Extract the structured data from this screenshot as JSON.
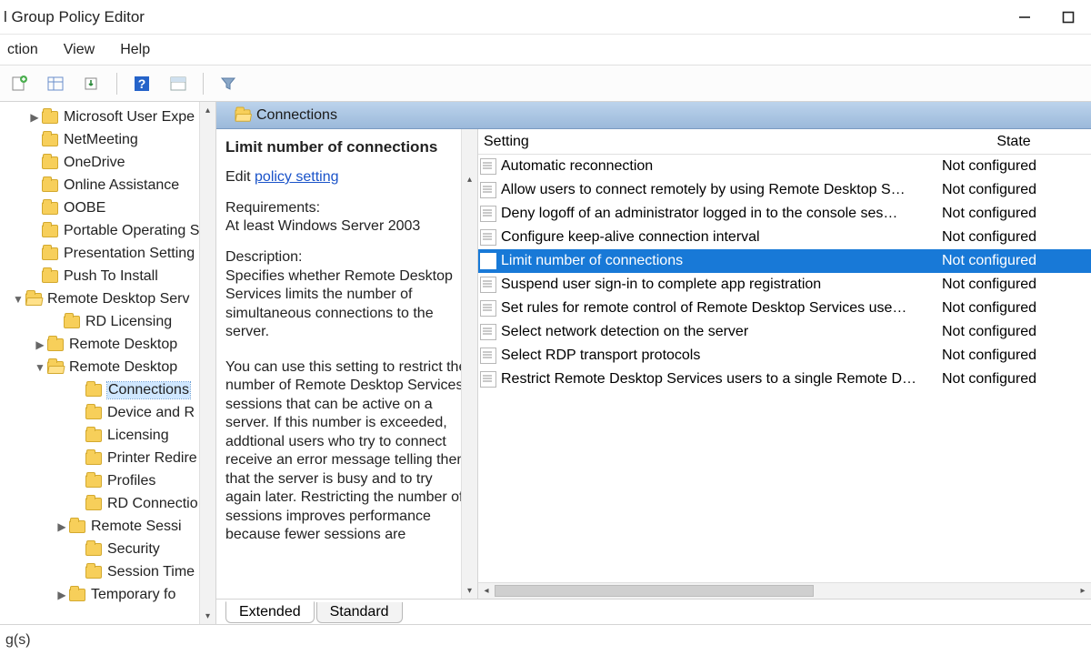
{
  "window": {
    "title": "l Group Policy Editor"
  },
  "menu": {
    "items": [
      "ction",
      "View",
      "Help"
    ]
  },
  "toolbar": {
    "buttons": [
      "new",
      "show-hide-tree",
      "export",
      "help",
      "properties",
      "filter"
    ]
  },
  "tree": {
    "items": [
      {
        "label": "Microsoft User Expe",
        "indent": 46,
        "disclosure": "▶"
      },
      {
        "label": "NetMeeting",
        "indent": 46
      },
      {
        "label": "OneDrive",
        "indent": 46
      },
      {
        "label": "Online Assistance",
        "indent": 46
      },
      {
        "label": "OOBE",
        "indent": 46
      },
      {
        "label": "Portable Operating S",
        "indent": 46
      },
      {
        "label": "Presentation Setting",
        "indent": 46
      },
      {
        "label": "Push To Install",
        "indent": 46
      },
      {
        "label": "Remote Desktop Serv",
        "indent": 28,
        "disclosure": "▼",
        "open": true
      },
      {
        "label": "RD Licensing",
        "indent": 70
      },
      {
        "label": "Remote Desktop",
        "indent": 52,
        "disclosure": "▶"
      },
      {
        "label": "Remote Desktop",
        "indent": 52,
        "disclosure": "▼",
        "open": true
      },
      {
        "label": "Connections",
        "indent": 94,
        "selected": true
      },
      {
        "label": "Device and R",
        "indent": 94
      },
      {
        "label": "Licensing",
        "indent": 94
      },
      {
        "label": "Printer Redire",
        "indent": 94
      },
      {
        "label": "Profiles",
        "indent": 94
      },
      {
        "label": "RD Connectio",
        "indent": 94
      },
      {
        "label": "Remote Sessi",
        "indent": 76,
        "disclosure": "▶"
      },
      {
        "label": "Security",
        "indent": 94
      },
      {
        "label": "Session Time",
        "indent": 94
      },
      {
        "label": "Temporary fo",
        "indent": 76,
        "disclosure": "▶"
      }
    ]
  },
  "pathHeader": {
    "label": "Connections"
  },
  "description": {
    "heading": "Limit number of connections",
    "editPrefix": "Edit ",
    "editLink": "policy setting",
    "reqLabel": "Requirements:",
    "reqValue": "At least Windows Server 2003",
    "descLabel": "Description:",
    "body1": "Specifies whether Remote Desktop Services limits the number of simultaneous connections to the server.",
    "body2": "You can use this setting to restrict the number of Remote Desktop Services sessions that can be active on a server. If this number is exceeded, addtional users who try to connect receive an error message telling them that the server is busy and to try again later. Restricting the number of sessions improves performance because fewer sessions are"
  },
  "list": {
    "columns": {
      "setting": "Setting",
      "state": "State"
    },
    "rows": [
      {
        "label": "Automatic reconnection",
        "state": "Not configured"
      },
      {
        "label": "Allow users to connect remotely by using Remote Desktop S…",
        "state": "Not configured"
      },
      {
        "label": "Deny logoff of an administrator logged in to the console ses…",
        "state": "Not configured"
      },
      {
        "label": "Configure keep-alive connection interval",
        "state": "Not configured"
      },
      {
        "label": "Limit number of connections",
        "state": "Not configured",
        "selected": true
      },
      {
        "label": "Suspend user sign-in to complete app registration",
        "state": "Not configured"
      },
      {
        "label": "Set rules for remote control of Remote Desktop Services use…",
        "state": "Not configured"
      },
      {
        "label": "Select network detection on the server",
        "state": "Not configured"
      },
      {
        "label": "Select RDP transport protocols",
        "state": "Not configured"
      },
      {
        "label": "Restrict Remote Desktop Services users to a single Remote D…",
        "state": "Not configured"
      }
    ]
  },
  "tabs": {
    "extended": "Extended",
    "standard": "Standard"
  },
  "status": {
    "text": "g(s)"
  }
}
